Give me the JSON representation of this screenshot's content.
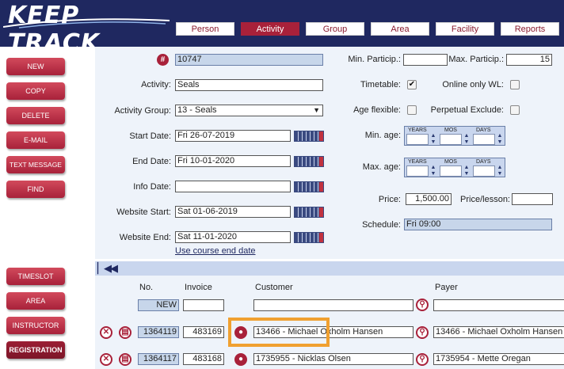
{
  "app": {
    "logo": "KEEP TRACK"
  },
  "nav": {
    "tabs": [
      {
        "label": "Person"
      },
      {
        "label": "Activity"
      },
      {
        "label": "Group"
      },
      {
        "label": "Area"
      },
      {
        "label": "Facility"
      },
      {
        "label": "Reports"
      }
    ]
  },
  "sidebar": {
    "top": [
      {
        "label": "NEW"
      },
      {
        "label": "COPY"
      },
      {
        "label": "DELETE"
      },
      {
        "label": "E-MAIL"
      },
      {
        "label": "TEXT MESSAGE"
      },
      {
        "label": "FIND"
      }
    ],
    "bottom": [
      {
        "label": "TIMESLOT"
      },
      {
        "label": "AREA"
      },
      {
        "label": "INSTRUCTOR"
      },
      {
        "label": "REGISTRATION"
      }
    ]
  },
  "form": {
    "id_value": "10747",
    "activity_label": "Activity:",
    "activity_value": "Seals",
    "group_label": "Activity Group:",
    "group_value": "13 - Seals",
    "start_label": "Start Date:",
    "start_value": "Fri 26-07-2019",
    "end_label": "End Date:",
    "end_value": "Fri 10-01-2020",
    "info_label": "Info Date:",
    "info_value": "",
    "web_start_label": "Website Start:",
    "web_start_value": "Sat 01-06-2019",
    "web_end_label": "Website End:",
    "web_end_value": "Sat 11-01-2020",
    "use_end_link": "Use course end date",
    "min_particip_label": "Min. Particip.:",
    "min_particip_value": "",
    "max_particip_label": "Max. Particip.:",
    "max_particip_value": "15",
    "timetable_label": "Timetable:",
    "timetable_checked": true,
    "online_wl_label": "Online only WL:",
    "age_flexible_label": "Age flexible:",
    "perpetual_label": "Perpetual Exclude:",
    "min_age_label": "Min. age:",
    "max_age_label": "Max. age:",
    "age_years": "YEARS",
    "age_mos": "MOS",
    "age_days": "DAYS",
    "price_label": "Price:",
    "price_value": "1,500.00",
    "price_lesson_label": "Price/lesson:",
    "price_lesson_value": "",
    "schedule_label": "Schedule:",
    "schedule_value": "Fri 09:00"
  },
  "registrations": {
    "headers": {
      "no": "No.",
      "invoice": "Invoice",
      "customer": "Customer",
      "payer": "Payer"
    },
    "new_label": "NEW",
    "rows": [
      {
        "no": "1364119",
        "invoice": "483169",
        "customer": "13466 - Michael Oxholm Hansen",
        "payer": "13466 - Michael Oxholm Hansen"
      },
      {
        "no": "1364117",
        "invoice": "483168",
        "customer": "1735955 - Nicklas Olsen",
        "payer": "1735954 - Mette Oregan"
      }
    ]
  },
  "colors": {
    "brand_navy": "#1f2860",
    "accent_red": "#a8213a",
    "highlight": "#f0a030"
  }
}
